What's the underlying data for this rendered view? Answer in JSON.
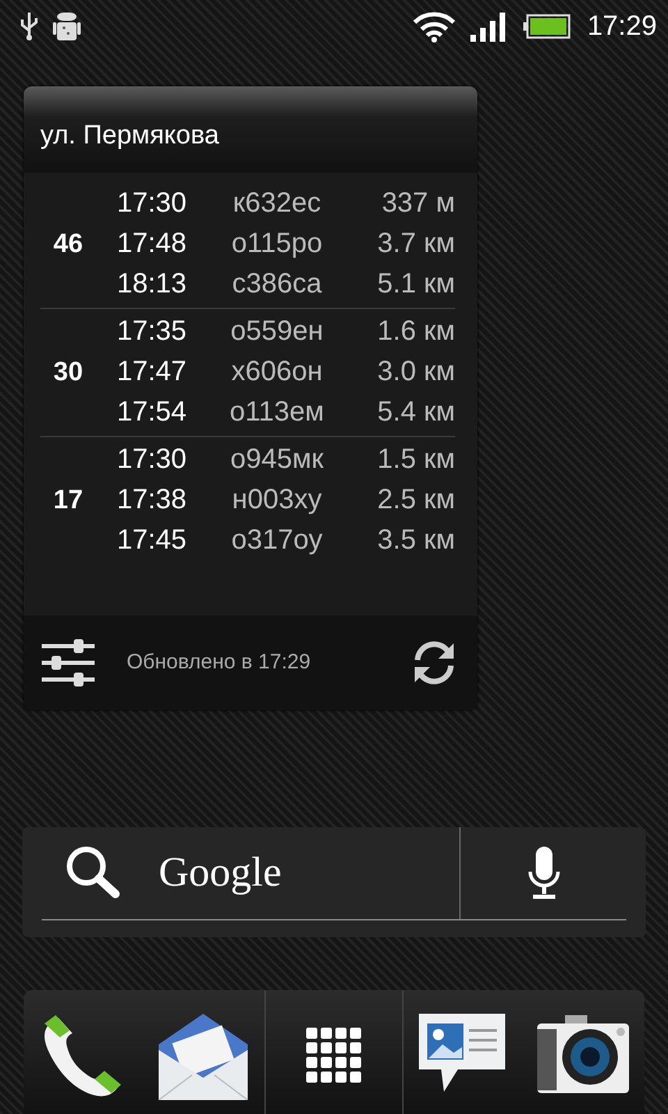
{
  "status_bar": {
    "time": "17:29"
  },
  "widget": {
    "title": "ул. Пермякова",
    "routes": [
      {
        "number": "46",
        "arrivals": [
          {
            "time": "17:30",
            "plate": "к632ес",
            "distance": "337 м"
          },
          {
            "time": "17:48",
            "plate": "о115ро",
            "distance": "3.7 км"
          },
          {
            "time": "18:13",
            "plate": "с386са",
            "distance": "5.1 км"
          }
        ]
      },
      {
        "number": "30",
        "arrivals": [
          {
            "time": "17:35",
            "plate": "о559ен",
            "distance": "1.6 км"
          },
          {
            "time": "17:47",
            "plate": "х606он",
            "distance": "3.0 км"
          },
          {
            "time": "17:54",
            "plate": "о113ем",
            "distance": "5.4 км"
          }
        ]
      },
      {
        "number": "17",
        "arrivals": [
          {
            "time": "17:30",
            "plate": "о945мк",
            "distance": "1.5 км"
          },
          {
            "time": "17:38",
            "plate": "н003ху",
            "distance": "2.5 км"
          },
          {
            "time": "17:45",
            "plate": "о317оу",
            "distance": "3.5 км"
          }
        ]
      }
    ],
    "updated": "Обновлено в 17:29"
  },
  "search_widget": {
    "logo": "Google"
  }
}
